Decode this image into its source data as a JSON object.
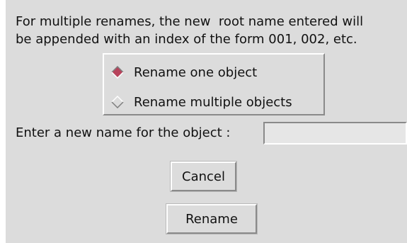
{
  "dialog": {
    "description_lines": [
      "For multiple renames, the new  root name entered will",
      "be appended with an index of the form 001, 002, etc."
    ],
    "options": [
      {
        "label": "Rename one object",
        "selected": true,
        "icon": "diamond-radio-icon"
      },
      {
        "label": "Rename multiple objects",
        "selected": false,
        "icon": "diamond-radio-icon"
      }
    ],
    "name_field": {
      "label": "Enter a new name for the object :",
      "value": "",
      "placeholder": ""
    },
    "buttons": {
      "cancel_label": "Cancel",
      "rename_label": "Rename"
    }
  },
  "colors": {
    "dialog_background": "#dcdcdc",
    "selected_radio": "#b7435b",
    "highlight": "#ffffff",
    "shadow": "#8a8a8a",
    "input_background": "#e6e6e6"
  }
}
